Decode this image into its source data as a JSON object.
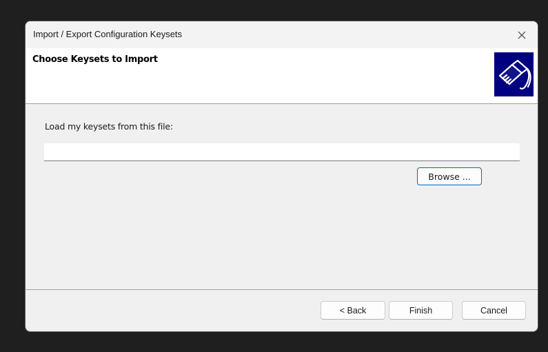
{
  "window": {
    "title": "Import / Export Configuration Keysets",
    "close_icon": "close-icon"
  },
  "header": {
    "title": "Choose Keysets to Import",
    "icon": "connector-plug-icon",
    "icon_bg": "#000080"
  },
  "main": {
    "file_label": "Load my keysets from this file:",
    "file_value": "",
    "browse_label": "Browse ..."
  },
  "footer": {
    "back_label": "< Back",
    "finish_label": "Finish",
    "cancel_label": "Cancel"
  },
  "colors": {
    "focus_accent": "#0067c0",
    "dialog_bg": "#f0f0f0",
    "header_bg": "#ffffff"
  }
}
